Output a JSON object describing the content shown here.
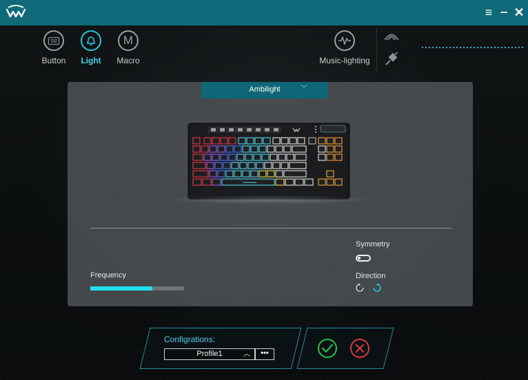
{
  "titlebar": {
    "menu_icon": "≡",
    "minimize_icon": "−",
    "close_icon": "✕"
  },
  "nav": [
    {
      "label": "Button",
      "icon": "keyboard-icon"
    },
    {
      "label": "Light",
      "icon": "bell-icon",
      "active": true
    },
    {
      "label": "Macro",
      "icon": "macro-m-icon"
    },
    {
      "label": "Music-lighting",
      "icon": "waveform-icon"
    }
  ],
  "light": {
    "mode": "Ambilight",
    "symmetry_label": "Symmetry",
    "symmetry_on": false,
    "direction_label": "Direction",
    "frequency_label": "Frequency",
    "frequency_level": 0.66
  },
  "config": {
    "title": "Configrations:",
    "profile": "Profile1",
    "more": "•••"
  },
  "colors": {
    "accent": "#1fe0ee",
    "titlebar": "#0e6a79",
    "confirm": "#26c244",
    "cancel": "#d83a3a"
  }
}
